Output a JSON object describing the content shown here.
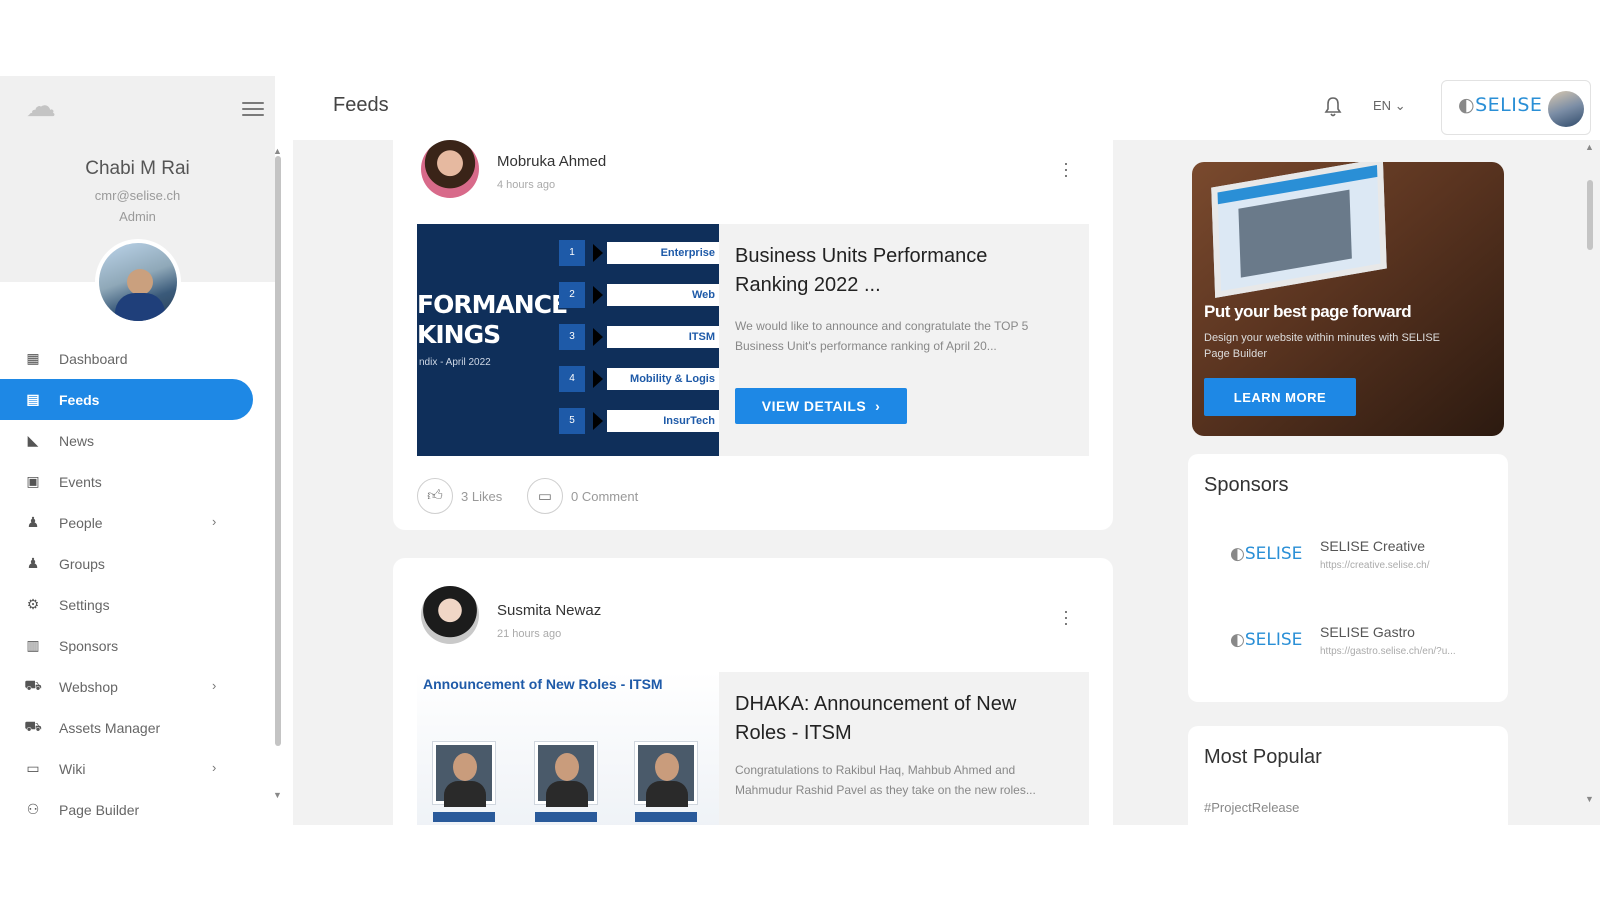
{
  "sidebar": {
    "user": {
      "name": "Chabi M Rai",
      "email": "cmr@selise.ch",
      "role": "Admin"
    },
    "nav": [
      {
        "label": "Dashboard",
        "icon": "dashboard-icon",
        "glyph": "▦"
      },
      {
        "label": "Feeds",
        "icon": "feeds-icon",
        "glyph": "▤",
        "active": true
      },
      {
        "label": "News",
        "icon": "news-icon",
        "glyph": "◣"
      },
      {
        "label": "Events",
        "icon": "calendar-icon",
        "glyph": "▣"
      },
      {
        "label": "People",
        "icon": "people-icon",
        "glyph": "♟",
        "chevron": true
      },
      {
        "label": "Groups",
        "icon": "groups-icon",
        "glyph": "♟"
      },
      {
        "label": "Settings",
        "icon": "gear-icon",
        "glyph": "⚙"
      },
      {
        "label": "Sponsors",
        "icon": "sponsors-icon",
        "glyph": "▥"
      },
      {
        "label": "Webshop",
        "icon": "cart-icon",
        "glyph": "⛟",
        "chevron": true
      },
      {
        "label": "Assets Manager",
        "icon": "assets-cart-icon",
        "glyph": "⛟"
      },
      {
        "label": "Wiki",
        "icon": "wiki-icon",
        "glyph": "▭",
        "chevron": true
      },
      {
        "label": "Page Builder",
        "icon": "page-builder-icon",
        "glyph": "⚇"
      }
    ]
  },
  "header": {
    "title": "Feeds",
    "language": "EN",
    "brand": "SELISE"
  },
  "posts": [
    {
      "author": "Mobruka Ahmed",
      "time": "4 hours ago",
      "title": "Business Units Performance Ranking 2022 ...",
      "excerpt": "We would like to announce and congratulate the TOP 5 Business Unit's performance ranking of April 20...",
      "button": "VIEW DETAILS",
      "image": {
        "headline_1": "FORMANCE",
        "headline_2": "KINGS",
        "subline": "ndix - April 2022",
        "ranks": [
          {
            "num": "1",
            "label": "Enterprise"
          },
          {
            "num": "2",
            "label": "Web"
          },
          {
            "num": "3",
            "label": "ITSM"
          },
          {
            "num": "4",
            "label": "Mobility & Logis"
          },
          {
            "num": "5",
            "label": "InsurTech"
          }
        ]
      },
      "likes": "3 Likes",
      "comments": "0 Comment"
    },
    {
      "author": "Susmita Newaz",
      "time": "21 hours ago",
      "title": "DHAKA: Announcement of New Roles - ITSM",
      "excerpt": "Congratulations to Rakibul Haq, Mahbub Ahmed and Mahmudur Rashid Pavel as they take on the new roles...",
      "image": {
        "heading": "Announcement of New Roles - ITSM"
      }
    }
  ],
  "promo": {
    "title": "Put your best page forward",
    "text": "Design your website within minutes with SELISE Page Builder",
    "button": "LEARN MORE"
  },
  "sponsors": {
    "title": "Sponsors",
    "items": [
      {
        "name": "SELISE Creative",
        "url": "https://creative.selise.ch/",
        "logo": "SELISE"
      },
      {
        "name": "SELISE Gastro",
        "url": "https://gastro.selise.ch/en/?u...",
        "logo": "SELISE"
      }
    ]
  },
  "popular": {
    "title": "Most Popular",
    "first_tag": "#ProjectRelease"
  },
  "colors": {
    "accent": "#1e88e5",
    "sidebar_head": "#f0f0f0",
    "background": "#f2f2f2"
  }
}
